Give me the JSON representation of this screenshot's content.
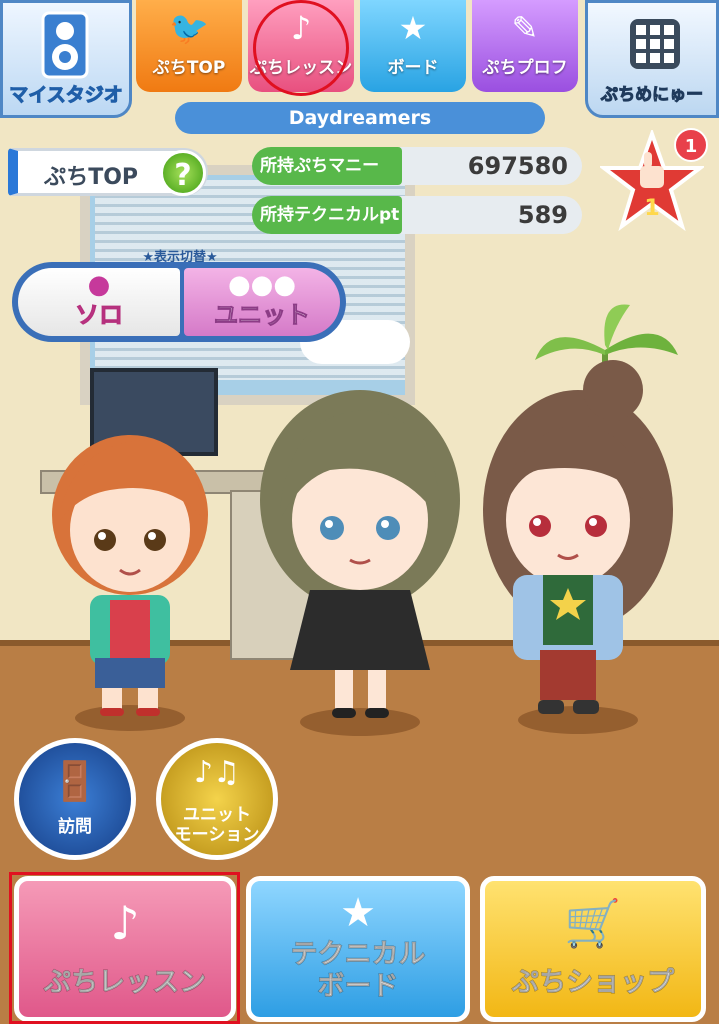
{
  "header": {
    "my_studio": "マイスタジオ",
    "tabs": [
      {
        "label": "ぷちTOP",
        "icon": "bird-icon"
      },
      {
        "label": "ぷちレッスン",
        "icon": "music-note-icon"
      },
      {
        "label": "ボード",
        "icon": "star-icon"
      },
      {
        "label": "ぷちプロフ",
        "icon": "memo-icon"
      }
    ],
    "menu_label": "ぷちめにゅー",
    "title": "Daydreamers"
  },
  "section": {
    "title": "ぷちTOP",
    "help": "?"
  },
  "stats": [
    {
      "label": "所持ぷちマニー",
      "value": "697580"
    },
    {
      "label": "所持テクニカルpt",
      "value": "589"
    }
  ],
  "like": {
    "rank": "1",
    "badge": "1"
  },
  "display_toggle": {
    "caption": "★表示切替★",
    "solo": "ソロ",
    "unit": "ユニット"
  },
  "actions": {
    "visit": "訪問",
    "unit_motion_line1": "ユニット",
    "unit_motion_line2": "モーション"
  },
  "bottom": {
    "lesson": "ぷちレッスン",
    "board_line1": "テクニカル",
    "board_line2": "ボード",
    "shop": "ぷちショップ"
  }
}
